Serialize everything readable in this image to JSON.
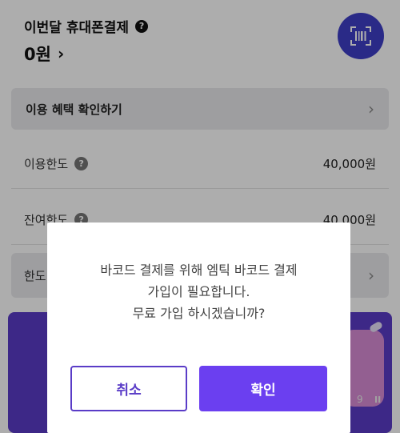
{
  "header": {
    "title": "이번달 휴대폰결제",
    "help_icon_glyph": "?",
    "amount": "0원",
    "amount_chevron": "›"
  },
  "benefit": {
    "label": "이용 혜택 확인하기",
    "chevron": "›"
  },
  "limits": [
    {
      "label": "이용한도",
      "help_glyph": "?",
      "value": "40,000원"
    },
    {
      "label": "잔여한도",
      "help_glyph": "?",
      "value": "40,000원"
    }
  ],
  "change_row": {
    "label": "한도",
    "chevron": "›"
  },
  "banner": {
    "counter": "9",
    "pause_glyph": "II"
  },
  "dialog": {
    "message_lines": [
      "바코드 결제를 위해 엠틱 바코드 결제",
      "가입이 필요합니다.",
      "무료 가입 하시겠습니까?"
    ],
    "cancel_label": "취소",
    "confirm_label": "확인"
  },
  "colors": {
    "accent": "#6b3ff0",
    "barcode_button": "#3e3ec7",
    "banner": "#5a3cc7",
    "row_background": "#e9e9ec"
  },
  "icons": {
    "barcode": "barcode-scan-icon",
    "help": "question-circle-icon",
    "chevron": "chevron-right-icon",
    "pause": "pause-icon"
  }
}
